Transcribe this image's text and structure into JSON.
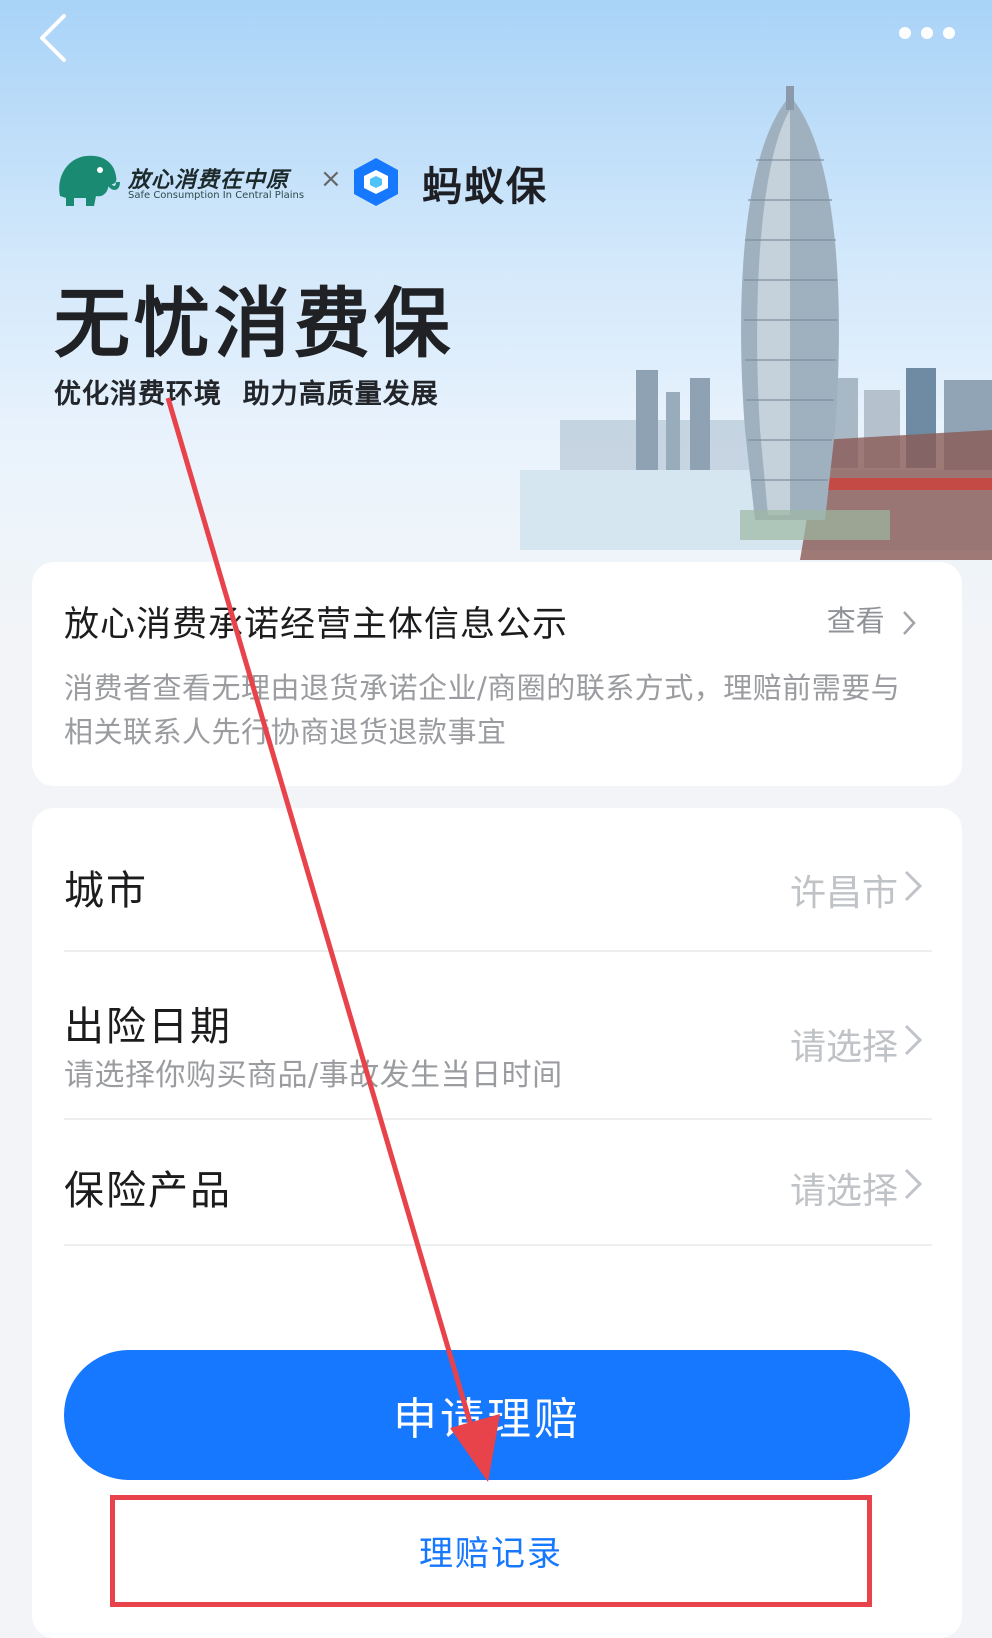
{
  "nav": {
    "back_icon": "chevron-left-icon",
    "more_icon": "more-dots-icon"
  },
  "hero": {
    "partner_logo_cn": "放心消费在中原",
    "partner_logo_en": "Safe Consumption In Central Plains",
    "separator": "×",
    "brand_name": "蚂蚁保",
    "title": "无忧消费保",
    "subtitle": "优化消费环境  助力高质量发展"
  },
  "notice_card": {
    "title": "放心消费承诺经营主体信息公示",
    "link_label": "查看",
    "description": "消费者查看无理由退货承诺企业/商圈的联系方式，理赔前需要与相关联系人先行协商退货退款事宜"
  },
  "form": {
    "city": {
      "label": "城市",
      "value": "许昌市"
    },
    "accident_date": {
      "label": "出险日期",
      "hint": "请选择你购买商品/事故发生当日时间",
      "value": "请选择"
    },
    "insurance_product": {
      "label": "保险产品",
      "value": "请选择"
    }
  },
  "actions": {
    "apply_claim": "申请理赔",
    "claim_records": "理赔记录"
  },
  "colors": {
    "primary": "#1677ff",
    "annotation": "#e8434b"
  }
}
